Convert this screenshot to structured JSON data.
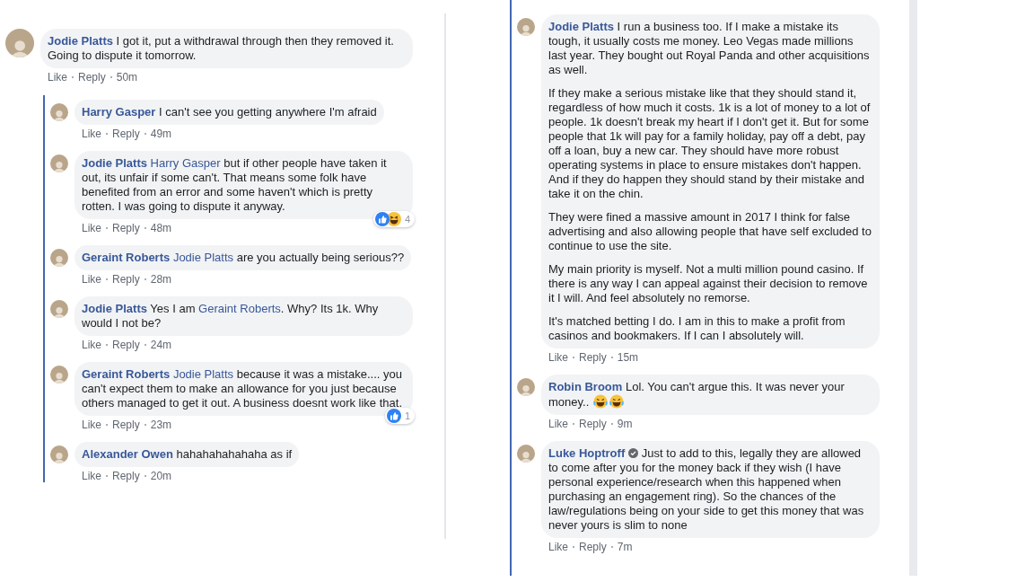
{
  "panels": [
    {
      "top_comment": {
        "author": "Jodie Platts",
        "verified": false,
        "paragraphs": [
          [
            {
              "kind": "text",
              "text": "I got it, put a withdrawal through then they removed it. Going to dispute it tomorrow."
            }
          ]
        ],
        "like": "Like",
        "reply": "Reply",
        "time": "50m"
      },
      "replies": [
        {
          "author": "Harry Gasper",
          "verified": false,
          "paragraphs": [
            [
              {
                "kind": "text",
                "text": "I can't see you getting anywhere I'm afraid"
              }
            ]
          ],
          "like": "Like",
          "reply": "Reply",
          "time": "49m"
        },
        {
          "author": "Jodie Platts",
          "verified": false,
          "paragraphs": [
            [
              {
                "kind": "mention",
                "text": "Harry Gasper"
              },
              {
                "kind": "text",
                "text": " but if other people have taken it out, its unfair if some can't. That means some folk have benefited from an error and some haven't which is pretty rotten. I was going to dispute it anyway."
              }
            ]
          ],
          "reactions": {
            "icons": [
              {
                "kind": "like"
              },
              {
                "kind": "haha"
              }
            ],
            "count": "4"
          },
          "like": "Like",
          "reply": "Reply",
          "time": "48m"
        },
        {
          "author": "Geraint Roberts",
          "verified": false,
          "paragraphs": [
            [
              {
                "kind": "mention",
                "text": "Jodie Platts"
              },
              {
                "kind": "text",
                "text": " are you actually being serious??"
              }
            ]
          ],
          "like": "Like",
          "reply": "Reply",
          "time": "28m"
        },
        {
          "author": "Jodie Platts",
          "verified": false,
          "paragraphs": [
            [
              {
                "kind": "text",
                "text": "Yes I am "
              },
              {
                "kind": "mention",
                "text": "Geraint Roberts"
              },
              {
                "kind": "text",
                "text": ". Why? Its 1k. Why would I not be?"
              }
            ]
          ],
          "like": "Like",
          "reply": "Reply",
          "time": "24m"
        },
        {
          "author": "Geraint Roberts",
          "verified": false,
          "paragraphs": [
            [
              {
                "kind": "mention",
                "text": "Jodie Platts"
              },
              {
                "kind": "text",
                "text": " because it was a mistake.... you can't expect them to make an allowance for you just because others managed to get it out. A business doesnt work like that."
              }
            ]
          ],
          "reactions": {
            "icons": [
              {
                "kind": "like"
              }
            ],
            "count": "1"
          },
          "like": "Like",
          "reply": "Reply",
          "time": "23m"
        },
        {
          "author": "Alexander Owen",
          "verified": false,
          "paragraphs": [
            [
              {
                "kind": "text",
                "text": "hahahahahahaha as if"
              }
            ]
          ],
          "like": "Like",
          "reply": "Reply",
          "time": "20m"
        }
      ]
    },
    {
      "replies": [
        {
          "author": "Jodie Platts",
          "verified": false,
          "paragraphs": [
            [
              {
                "kind": "text",
                "text": "I run a business too. If I make a mistake its tough, it usually costs me money. Leo Vegas made millions last year. They bought out Royal Panda and other acquisitions as well."
              }
            ],
            [
              {
                "kind": "text",
                "text": "If they make a serious mistake like that they should stand it, regardless of how much it costs. 1k is a lot of money to a lot of people. 1k doesn't break my heart if I don't get it. But for some people that 1k will pay for a family holiday, pay off a debt, pay off a loan, buy a new car. They should have more robust operating systems in place to ensure mistakes don't happen. And if they do happen they should stand by their mistake and take it on the chin."
              }
            ],
            [
              {
                "kind": "text",
                "text": "They were fined a massive amount in 2017 I think for false advertising and also allowing people that have self excluded to continue to use the site."
              }
            ],
            [
              {
                "kind": "text",
                "text": "My main priority is myself. Not a multi million pound casino. If there is any way I can appeal against their decision to remove it I will. And feel absolutely no remorse."
              }
            ],
            [
              {
                "kind": "text",
                "text": "It's matched betting I do. I am in this to make a profit from casinos and bookmakers. If I can I absolutely will."
              }
            ]
          ],
          "like": "Like",
          "reply": "Reply",
          "time": "15m"
        },
        {
          "author": "Robin Broom",
          "verified": false,
          "paragraphs": [
            [
              {
                "kind": "text",
                "text": "Lol. You can't argue this. It was never your money.. "
              },
              {
                "kind": "emoji"
              },
              {
                "kind": "emoji"
              }
            ]
          ],
          "like": "Like",
          "reply": "Reply",
          "time": "9m"
        },
        {
          "author": "Luke Hoptroff",
          "verified": true,
          "paragraphs": [
            [
              {
                "kind": "text",
                "text": "Just to add to this, legally they are allowed to come after you for the money back if they wish (I have personal experience/research when this happened when purchasing an engagement ring). So the chances of the law/regulations being on your side to get this money that was never yours is slim to none"
              }
            ]
          ],
          "like": "Like",
          "reply": "Reply",
          "time": "7m"
        }
      ]
    }
  ]
}
